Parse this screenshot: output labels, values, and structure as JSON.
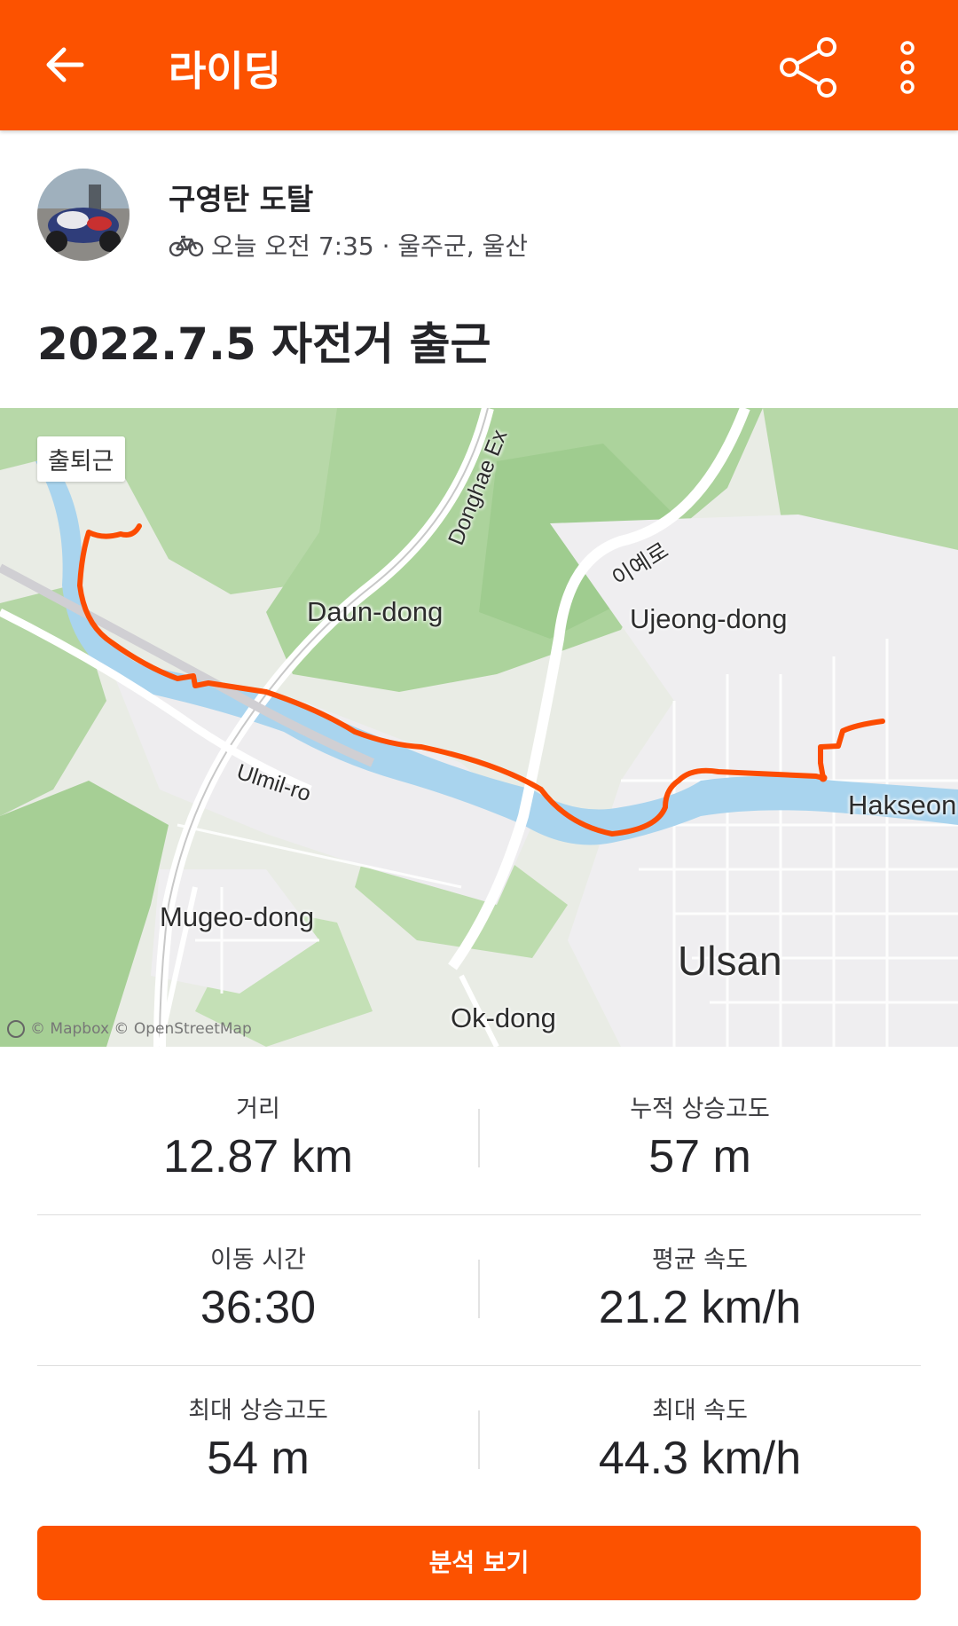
{
  "appbar": {
    "title": "라이딩",
    "icons": {
      "back": "arrow-left-icon",
      "share": "share-icon",
      "more": "more-vertical-icon"
    }
  },
  "athlete": {
    "name": "구영탄 도탈",
    "activity_icon": "bicycle-icon",
    "meta": "오늘 오전 7:35 · 울주군, 울산"
  },
  "activity": {
    "title": "2022.7.5 자전거 출근"
  },
  "map": {
    "tag": "출퇴근",
    "attribution": "© Mapbox © OpenStreetMap",
    "route_color": "#fc4c02",
    "labels": {
      "daun": "Daun-dong",
      "ujeong": "Ujeong-dong",
      "mugeo": "Mugeo-dong",
      "ulsan": "Ulsan",
      "ok": "Ok-dong",
      "hakseong": "Hakseon",
      "ulmil": "Ulmil-ro",
      "donghae": "Donghae Ex",
      "iye": "이예로"
    }
  },
  "stats": [
    [
      {
        "label": "거리",
        "value": "12.87 km"
      },
      {
        "label": "누적 상승고도",
        "value": "57 m"
      }
    ],
    [
      {
        "label": "이동 시간",
        "value": "36:30"
      },
      {
        "label": "평균 속도",
        "value": "21.2 km/h"
      }
    ],
    [
      {
        "label": "최대 상승고도",
        "value": "54 m"
      },
      {
        "label": "최대 속도",
        "value": "44.3 km/h"
      }
    ]
  ],
  "cta": {
    "label": "분석 보기"
  },
  "colors": {
    "brand": "#fc5200"
  }
}
